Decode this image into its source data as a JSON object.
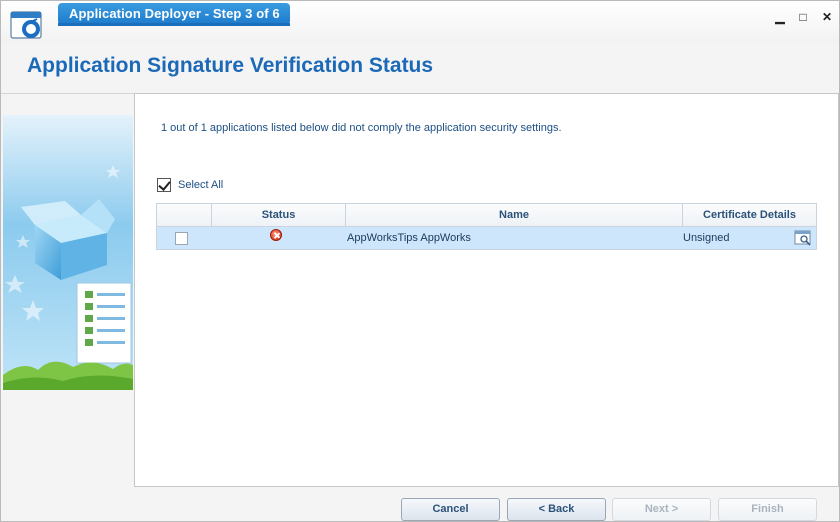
{
  "window": {
    "title": "Application Deployer - Step 3 of 6",
    "minimize_label": "▁",
    "maximize_label": "□",
    "close_label": "✕"
  },
  "header": {
    "title": "Application Signature Verification Status"
  },
  "content": {
    "message": "1 out of 1 applications listed below did not comply the application security settings.",
    "select_all_label": "Select All",
    "select_all_checked": true
  },
  "table": {
    "columns": [
      "",
      "Status",
      "Name",
      "Certificate Details"
    ],
    "rows": [
      {
        "checked": false,
        "status_icon": "error-icon",
        "name": "AppWorksTips AppWorks",
        "certificate": "Unsigned",
        "details_icon": "view-details-icon"
      }
    ]
  },
  "footer": {
    "cancel_label": "Cancel",
    "back_label": "< Back",
    "next_label": "Next >",
    "finish_label": "Finish"
  },
  "colors": {
    "accent": "#1c69b8",
    "row_selected": "#cde6fb",
    "error": "#d22a10"
  }
}
